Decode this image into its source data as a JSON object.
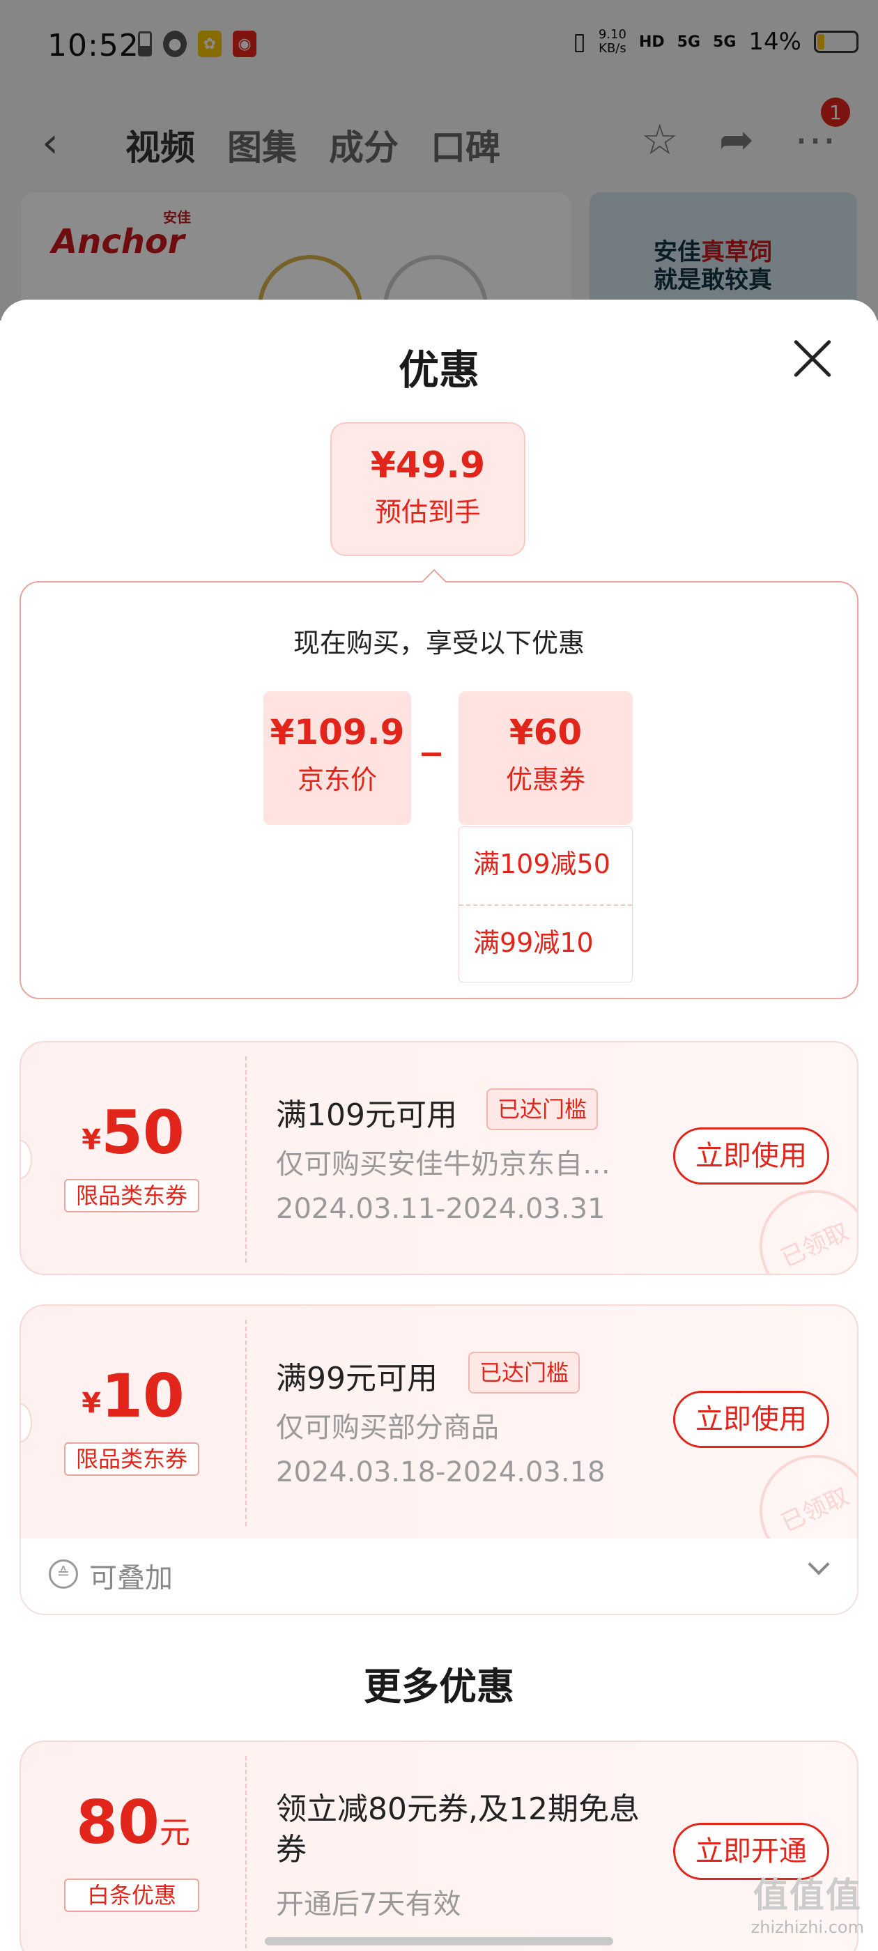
{
  "status": {
    "time": "10:52",
    "net_speed": "9.10\nKB/s",
    "hd": "HD",
    "sig1": "5G",
    "sig2": "5G",
    "battery": "14%"
  },
  "nav": {
    "tabs": [
      "视频",
      "图集",
      "成分",
      "口碑"
    ],
    "badge": "1"
  },
  "background": {
    "brand_cn": "安佳",
    "brand": "Anchor",
    "ad_line1": "安佳",
    "ad_em": "真草饲",
    "ad_line2": "就是敢较真"
  },
  "sheet": {
    "title": "优惠",
    "estimate_price": "¥49.9",
    "estimate_label": "预估到手",
    "calc_heading": "现在购买，享受以下优惠",
    "jd_price": "¥109.9",
    "jd_price_label": "京东价",
    "coupon_total": "¥60",
    "coupon_total_label": "优惠券",
    "coupon_breakdown": [
      "满109减50",
      "满99减10"
    ]
  },
  "coupons": [
    {
      "yen": "¥",
      "amount": "50",
      "tag": "限品类东券",
      "title": "满109元可用",
      "reached": "已达门槛",
      "desc": "仅可购买安佳牛奶京东自…",
      "date": "2024.03.11-2024.03.31",
      "action": "立即使用",
      "stamp": "已领取"
    },
    {
      "yen": "¥",
      "amount": "10",
      "tag": "限品类东券",
      "title": "满99元可用",
      "reached": "已达门槛",
      "desc": "仅可购买部分商品",
      "date": "2024.03.18-2024.03.18",
      "action": "立即使用",
      "stamp": "已领取"
    }
  ],
  "stackable": {
    "label": "可叠加"
  },
  "more": {
    "title": "更多优惠",
    "baitiao": {
      "amount": "80",
      "unit": "元",
      "tag": "白条优惠",
      "title": "领立减80元券,及12期免息券",
      "desc": "开通后7天有效",
      "action": "立即开通"
    }
  },
  "watermark": {
    "big": "值值值",
    "small": "zhizhizhi.com"
  },
  "colors": {
    "accent": "#e1251b",
    "coupon_bg": "#fff1ef"
  }
}
